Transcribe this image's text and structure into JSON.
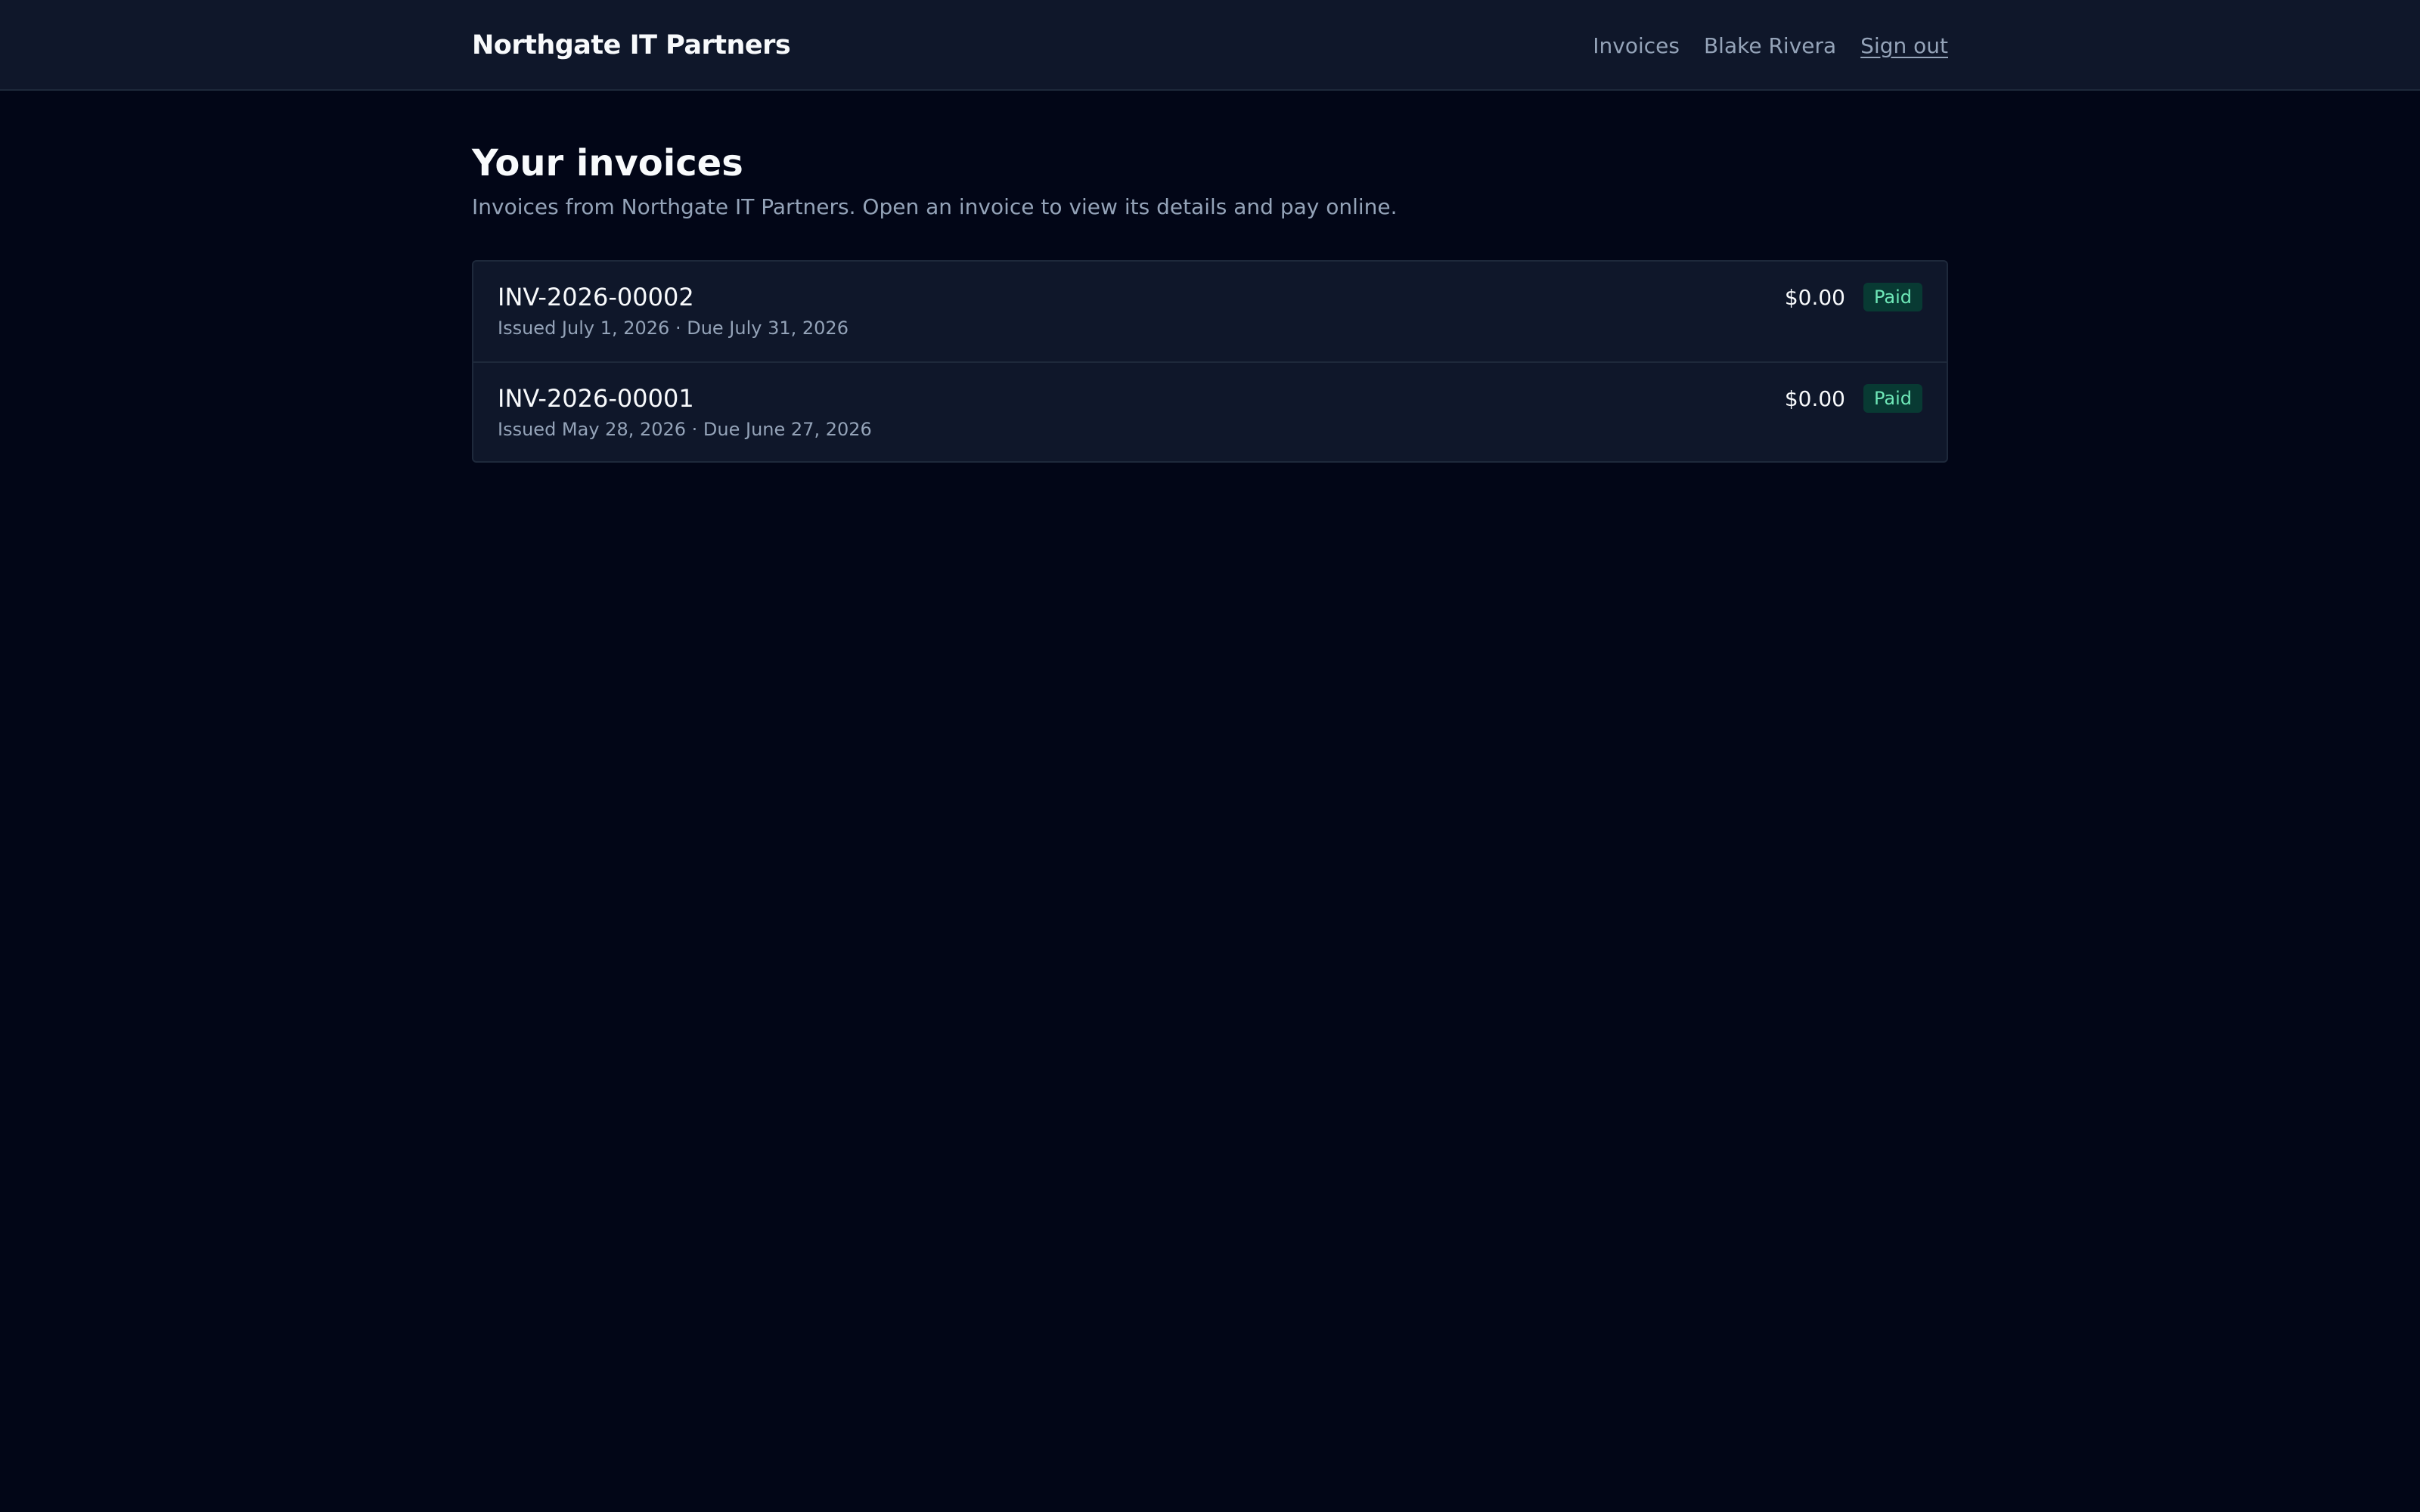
{
  "header": {
    "brand": "Northgate IT Partners",
    "nav_invoices": "Invoices",
    "user_name": "Blake Rivera",
    "sign_out": "Sign out"
  },
  "main": {
    "title": "Your invoices",
    "subtitle": "Invoices from Northgate IT Partners. Open an invoice to view its details and pay online."
  },
  "invoices": [
    {
      "number": "INV-2026-00002",
      "dates": "Issued July 1, 2026 · Due July 31, 2026",
      "amount": "$0.00",
      "status": "Paid"
    },
    {
      "number": "INV-2026-00001",
      "dates": "Issued May 28, 2026 · Due June 27, 2026",
      "amount": "$0.00",
      "status": "Paid"
    }
  ],
  "colors": {
    "background": "#020617",
    "header_bg": "#0f172a",
    "paid_text": "#6ee7b7",
    "paid_bg": "#083a33"
  }
}
